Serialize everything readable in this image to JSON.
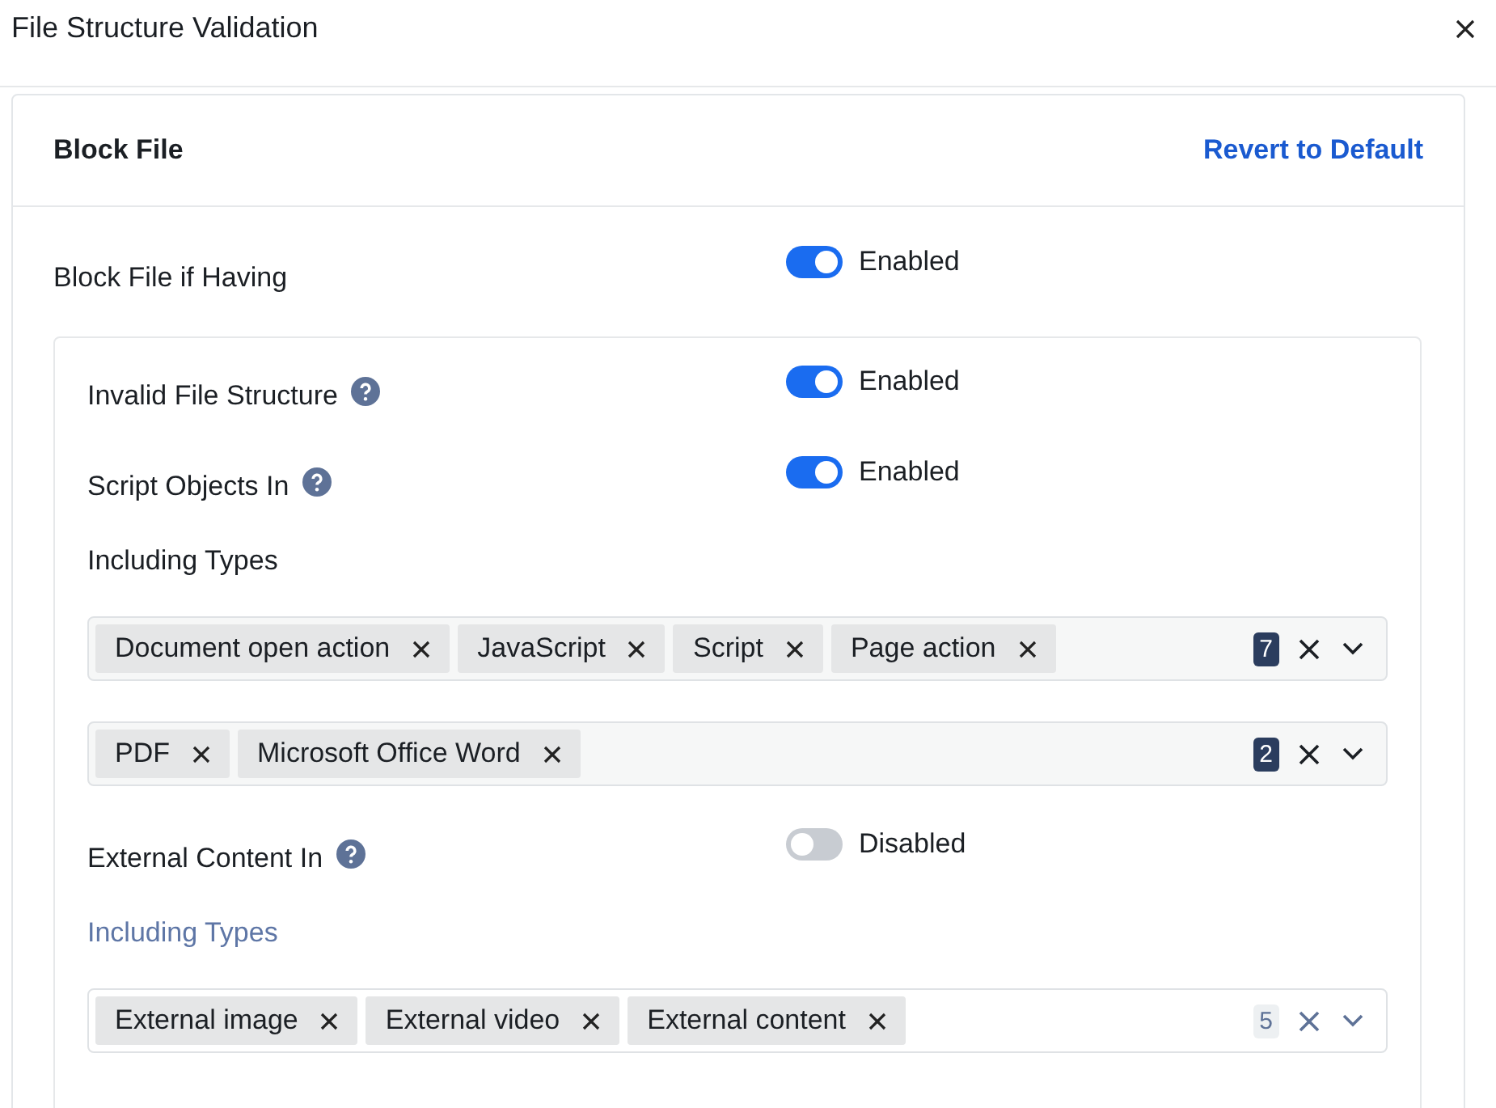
{
  "window": {
    "title": "File Structure Validation"
  },
  "card": {
    "title": "Block File",
    "revert_link": "Revert to Default"
  },
  "block_if_having": {
    "label": "Block File if Having",
    "on": true,
    "state_label": "Enabled"
  },
  "conditions": [
    {
      "kind": "toggle",
      "label": "Invalid File Structure",
      "help": true,
      "on": true,
      "state_label": "Enabled"
    },
    {
      "kind": "toggle",
      "label": "Script Objects In",
      "help": true,
      "on": true,
      "state_label": "Enabled"
    },
    {
      "kind": "heading",
      "label": "Including Types",
      "disabled": false
    },
    {
      "kind": "multiselect",
      "tags": [
        "Document open action",
        "JavaScript",
        "Script",
        "Page action"
      ],
      "count": "7",
      "disabled": false
    },
    {
      "kind": "multiselect",
      "tags": [
        "PDF",
        "Microsoft Office Word"
      ],
      "count": "2",
      "disabled": false
    },
    {
      "kind": "toggle",
      "label": "External Content In",
      "help": true,
      "on": false,
      "state_label": "Disabled"
    },
    {
      "kind": "heading",
      "label": "Including Types",
      "disabled": true
    },
    {
      "kind": "multiselect",
      "tags": [
        "External image",
        "External video",
        "External content"
      ],
      "count": "5",
      "disabled": true
    }
  ]
}
